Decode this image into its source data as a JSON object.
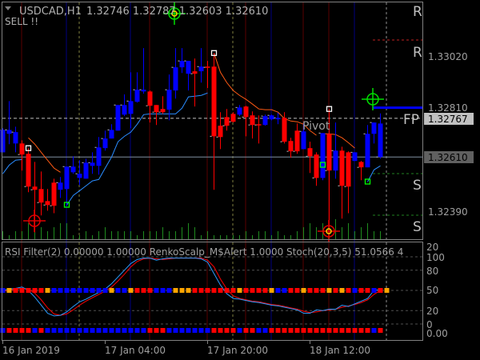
{
  "header": {
    "dropdown_icon": "triangle-down-icon",
    "symbol": "USDCAD,H1",
    "ohlc": "1.32746 1.32787 1.32603 1.32610",
    "signal": "SELL !!"
  },
  "indicator_header": "RSI Filter(2) 0.00000 1.00000  RenkoScalp_M$Alert 1.0000  Stoch(20,3,5) 51.0566 4",
  "level_labels": {
    "r1": "R",
    "r2": "R",
    "fp": "FP",
    "s1": "S",
    "s2": "S",
    "pivot": "Pivot"
  },
  "colors": {
    "bull": "#0000ff",
    "bear": "#ff0000",
    "volume": "#1f8c1f",
    "upper_stop": "#ff5a14",
    "lower_stop": "#2a8cff",
    "grid": "#808080",
    "orange": "#ffa500"
  },
  "chart_data": [
    {
      "type": "candlestick",
      "title": "USDCAD,H1",
      "price_axis_labels": [
        "1.33020",
        "1.32810",
        "1.32390"
      ],
      "price_highlight_labels": {
        "current": "1.32767",
        "line": "1.32610"
      },
      "ylim": [
        1.3225,
        1.3325
      ],
      "time_labels": [
        "16 Jan 2019",
        "17 Jan 04:00",
        "17 Jan 20:00",
        "18 Jan 12:00"
      ],
      "time_label_bar_index": [
        0,
        16,
        32,
        48
      ],
      "candle_colors": "bbbrrrrrrbbbbbbbbbbbbbbrrrbbbbrbrrrrrbrrrbbbrrrbrrbrbrrbrbbb",
      "candles_ohlc": [
        [
          1.32629,
          1.32727,
          1.32629,
          1.3272
        ],
        [
          1.32704,
          1.32837,
          1.32662,
          1.3272
        ],
        [
          1.32665,
          1.32733,
          1.32629,
          1.32711
        ],
        [
          1.32665,
          1.32678,
          1.32555,
          1.3262
        ],
        [
          1.32623,
          1.32646,
          1.32467,
          1.3249
        ],
        [
          1.3249,
          1.3259,
          1.32304,
          1.32477
        ],
        [
          1.3248,
          1.32551,
          1.32373,
          1.32425
        ],
        [
          1.32431,
          1.3248,
          1.32392,
          1.32415
        ],
        [
          1.32506,
          1.32522,
          1.32382,
          1.32412
        ],
        [
          1.32477,
          1.32529,
          1.32444,
          1.32506
        ],
        [
          1.3248,
          1.32571,
          1.32412,
          1.32571
        ],
        [
          1.32548,
          1.32613,
          1.32542,
          1.32571
        ],
        [
          1.32525,
          1.32597,
          1.32496,
          1.32542
        ],
        [
          1.32522,
          1.32603,
          1.32522,
          1.32587
        ],
        [
          1.32574,
          1.32629,
          1.32542,
          1.32587
        ],
        [
          1.32574,
          1.32691,
          1.32538,
          1.32649
        ],
        [
          1.32646,
          1.32717,
          1.32636,
          1.32685
        ],
        [
          1.32685,
          1.32743,
          1.32685,
          1.3272
        ],
        [
          1.32717,
          1.32821,
          1.32717,
          1.32821
        ],
        [
          1.32782,
          1.32864,
          1.32776,
          1.32821
        ],
        [
          1.32785,
          1.32954,
          1.32727,
          1.32837
        ],
        [
          1.32834,
          1.32954,
          1.32831,
          1.32883
        ],
        [
          1.32876,
          1.33052,
          1.32867,
          1.32883
        ],
        [
          1.32876,
          1.3288,
          1.3275,
          1.32818
        ],
        [
          1.32821,
          1.32821,
          1.3274,
          1.32792
        ],
        [
          1.32805,
          1.32857,
          1.32785,
          1.32792
        ],
        [
          1.32802,
          1.32945,
          1.32759,
          1.32883
        ],
        [
          1.3288,
          1.33052,
          1.32847,
          1.32974
        ],
        [
          1.32974,
          1.33052,
          1.32951,
          1.33
        ],
        [
          1.32948,
          1.33,
          1.3288,
          1.33
        ],
        [
          1.32958,
          1.3301,
          1.32815,
          1.32948
        ],
        [
          1.32958,
          1.33052,
          1.32912,
          1.32977
        ],
        [
          1.32977,
          1.33,
          1.3289,
          1.32974
        ],
        [
          1.32977,
          1.33032,
          1.32477,
          1.32694
        ],
        [
          1.32737,
          1.32792,
          1.32642,
          1.32691
        ],
        [
          1.32772,
          1.32805,
          1.32717,
          1.32737
        ],
        [
          1.32785,
          1.32792,
          1.3275,
          1.32753
        ],
        [
          1.32782,
          1.32821,
          1.32776,
          1.32811
        ],
        [
          1.32815,
          1.32818,
          1.32694,
          1.32772
        ],
        [
          1.32779,
          1.32795,
          1.32685,
          1.3274
        ],
        [
          1.32743,
          1.32779,
          1.32665,
          1.3274
        ],
        [
          1.3274,
          1.32782,
          1.32737,
          1.32776
        ],
        [
          1.32763,
          1.32782,
          1.32759,
          1.32779
        ],
        [
          1.32763,
          1.32789,
          1.32743,
          1.32769
        ],
        [
          1.32769,
          1.32792,
          1.32665,
          1.32672
        ],
        [
          1.32675,
          1.32688,
          1.32607,
          1.32633
        ],
        [
          1.32717,
          1.32746,
          1.32623,
          1.32633
        ],
        [
          1.32642,
          1.32746,
          1.32642,
          1.32714
        ],
        [
          1.32646,
          1.32672,
          1.32545,
          1.32613
        ],
        [
          1.3262,
          1.32629,
          1.32493,
          1.32525
        ],
        [
          1.32525,
          1.32707,
          1.32516,
          1.32707
        ],
        [
          1.32704,
          1.32805,
          1.32295,
          1.32555
        ],
        [
          1.32555,
          1.3275,
          1.32522,
          1.32636
        ],
        [
          1.32636,
          1.32652,
          1.3236,
          1.32493
        ],
        [
          1.32629,
          1.32633,
          1.32382,
          1.3249
        ],
        [
          1.32594,
          1.32629,
          1.32594,
          1.32629
        ],
        [
          1.3259,
          1.32594,
          1.32516,
          1.32568
        ],
        [
          1.32568,
          1.3274,
          1.32568,
          1.32704
        ],
        [
          1.32704,
          1.3275,
          1.32665,
          1.3275
        ],
        [
          1.32746,
          1.32787,
          1.32603,
          1.3261
        ]
      ],
      "volume_relative": [
        2,
        1,
        2,
        2,
        4,
        4,
        3,
        2,
        3,
        4,
        4,
        1,
        1,
        2,
        1,
        2,
        3,
        2,
        2,
        2,
        2,
        1,
        2,
        2,
        2,
        3,
        2,
        2,
        3,
        4,
        3,
        1,
        2,
        1,
        1,
        1,
        1,
        1,
        2,
        1,
        2,
        2,
        1,
        2,
        1,
        1,
        2,
        3,
        4,
        3,
        4,
        6,
        5,
        3,
        4,
        2,
        3,
        4,
        2,
        2
      ],
      "upper_stop_segments": [
        {
          "start": 4,
          "values": [
            1.32688,
            1.32662,
            1.32629,
            1.32597,
            1.32565,
            1.32548
          ]
        },
        {
          "start": 33,
          "values": [
            1.33032,
            1.32954,
            1.32912,
            1.3288,
            1.3286,
            1.32844,
            1.32825,
            1.32805,
            1.32802,
            1.32802,
            1.32792,
            1.32766,
            1.32756,
            1.32753,
            1.32743,
            1.32717,
            1.32698
          ]
        },
        {
          "start": 50,
          "values": [
            1.32704,
            1.32704,
            1.32701,
            1.32688,
            1.32668,
            1.32646
          ]
        }
      ],
      "lower_stop_segments": [
        {
          "start": 0,
          "values": [
            1.32542,
            1.32577,
            1.32597,
            1.326
          ]
        },
        {
          "start": 10,
          "values": [
            1.32415,
            1.32454,
            1.32473,
            1.32493,
            1.32513,
            1.32519,
            1.32565,
            1.3261,
            1.32672,
            1.32694,
            1.32711,
            1.32743,
            1.32782,
            1.32785,
            1.32785,
            1.32785,
            1.32785,
            1.32785,
            1.32808,
            1.32854,
            1.32857,
            1.3286,
            1.3287
          ]
        },
        {
          "start": 57,
          "values": [
            1.32509,
            1.32558,
            1.32574
          ]
        }
      ],
      "swing_high_markers": [
        4,
        33,
        51
      ],
      "swing_low_markers": [
        10,
        50,
        57
      ],
      "levels": {
        "R1": 1.332,
        "R2": 1.3307,
        "FP": 1.32767,
        "S1": 1.32545,
        "S2": 1.32385,
        "pivot_line": 1.3281,
        "price_line": 1.3261
      }
    },
    {
      "type": "line",
      "title": "Stoch(20,3,5)",
      "ylim": [
        0,
        100
      ],
      "y_tick_labels": [
        "100",
        "80",
        "50",
        "20",
        "0",
        "0.00"
      ],
      "main_line": [
        50,
        52,
        53,
        55,
        50,
        40,
        28,
        16,
        12,
        13,
        18,
        26,
        33,
        37,
        42,
        47,
        52,
        60,
        70,
        80,
        90,
        96,
        98,
        98,
        95,
        97,
        98,
        98,
        98,
        98,
        98,
        97,
        92,
        75,
        58,
        45,
        38,
        37,
        35,
        33,
        32,
        30,
        28,
        27,
        25,
        23,
        21,
        16,
        16,
        21,
        20,
        22,
        22,
        28,
        26,
        30,
        34,
        38,
        50,
        51
      ],
      "signal_line": [
        49,
        50,
        52,
        53,
        52,
        46,
        36,
        24,
        15,
        13,
        15,
        21,
        28,
        34,
        39,
        44,
        49,
        55,
        64,
        74,
        85,
        93,
        97,
        98,
        97,
        96,
        97,
        98,
        98,
        98,
        98,
        98,
        95,
        85,
        67,
        52,
        42,
        38,
        36,
        34,
        33,
        31,
        29,
        28,
        26,
        24,
        22,
        19,
        17,
        18,
        20,
        21,
        22,
        25,
        27,
        29,
        32,
        36,
        44,
        50
      ],
      "renko_row": "borrrrrobbbbbbbbbobborrrbbbooorrrrrrrorrrrobbrrorrrororbrrbro",
      "rsi_filter_row": "brrrrbrbbbbbbbbbbbbbbbbrrrbbbbbbbrrrrbrrbbrrrrrrrrrrrrrrrrbr"
    }
  ]
}
